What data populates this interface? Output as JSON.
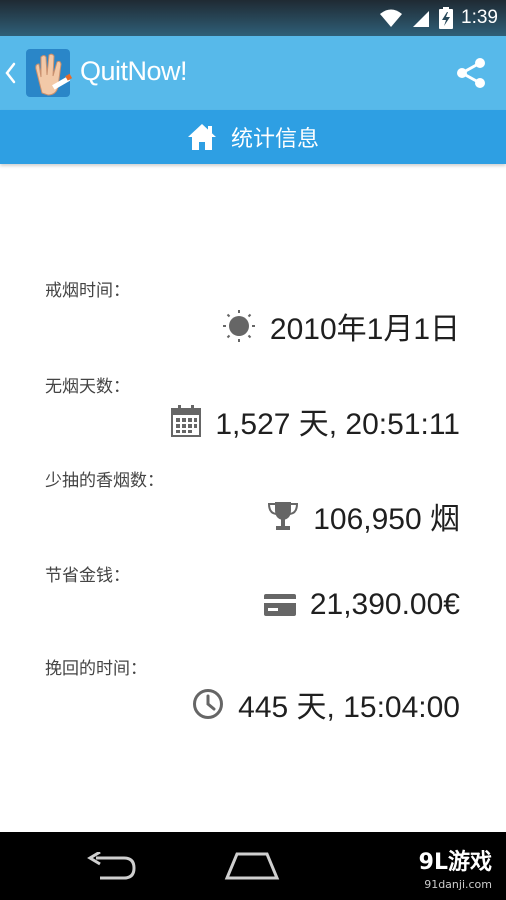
{
  "status_bar": {
    "time": "1:39"
  },
  "app_bar": {
    "title_part1": "Quit",
    "title_part2": "Now!"
  },
  "sub_bar": {
    "title": "统计信息"
  },
  "stats": [
    {
      "label": "戒烟时间：",
      "value": "2010年1月1日",
      "icon": "sun-icon"
    },
    {
      "label": "无烟天数：",
      "value": "1,527 天, 20:51:11",
      "icon": "calendar-icon"
    },
    {
      "label": "少抽的香烟数：",
      "value": "106,950 烟",
      "icon": "trophy-icon"
    },
    {
      "label": "节省金钱：",
      "value": "21,390.00€",
      "icon": "credit-card-icon"
    },
    {
      "label": "挽回的时间：",
      "value": "445 天, 15:04:00",
      "icon": "clock-icon"
    }
  ],
  "watermark": {
    "main": "9L游戏",
    "sub": "91danji.com"
  },
  "colors": {
    "app_bar": "#57b9ea",
    "sub_bar": "#2e9fe3",
    "icon_gray": "#666666"
  }
}
